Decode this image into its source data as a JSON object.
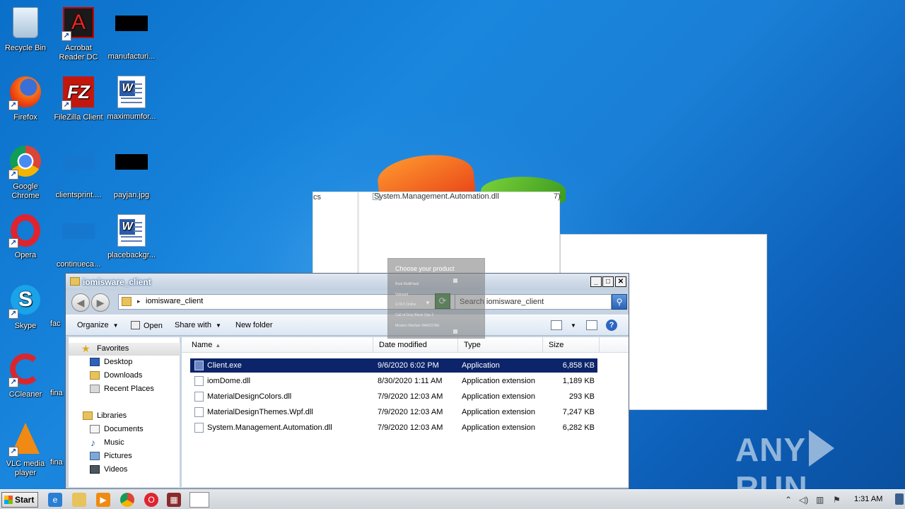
{
  "desktop": {
    "icons": [
      {
        "label": "Recycle Bin",
        "icon": "recycle-bin-icon"
      },
      {
        "label": "Acrobat Reader DC",
        "icon": "acrobat-icon"
      },
      {
        "label": "manufacturi...",
        "icon": "black-thumbnail-icon"
      },
      {
        "label": "Firefox",
        "icon": "firefox-icon"
      },
      {
        "label": "FileZilla Client",
        "icon": "filezilla-icon"
      },
      {
        "label": "maximumfor...",
        "icon": "word-document-icon"
      },
      {
        "label": "Google Chrome",
        "icon": "chrome-icon"
      },
      {
        "label": "clientsprint....",
        "icon": "blue-thumbnail-icon"
      },
      {
        "label": "payjan.jpg",
        "icon": "black-thumbnail-icon"
      },
      {
        "label": "Opera",
        "icon": "opera-icon"
      },
      {
        "label": "continueca...",
        "icon": "blue-thumbnail-icon"
      },
      {
        "label": "placebackgr...",
        "icon": "word-document-icon"
      },
      {
        "label": "Skype",
        "icon": "skype-icon"
      },
      {
        "label": "fac",
        "icon": "partial-icon"
      },
      {
        "label": "CCleaner",
        "icon": "ccleaner-icon"
      },
      {
        "label": "fina",
        "icon": "partial-icon"
      },
      {
        "label": "VLC media player",
        "icon": "vlc-icon"
      },
      {
        "label": "fina",
        "icon": "partial-icon"
      }
    ]
  },
  "background_windows": {
    "left_text": "cs",
    "file_text": "System.Management.Automation.dll",
    "right_fragment": "7)"
  },
  "explorer": {
    "title": "iomisware_client",
    "address_path": "iomisware_client",
    "search_placeholder": "Search iomisware_client",
    "toolbar": {
      "organize": "Organize",
      "open": "Open",
      "share_with": "Share with",
      "new_folder": "New folder"
    },
    "nav": {
      "favorites": "Favorites",
      "desktop": "Desktop",
      "downloads": "Downloads",
      "recent_places": "Recent Places",
      "libraries": "Libraries",
      "documents": "Documents",
      "music": "Music",
      "pictures": "Pictures",
      "videos": "Videos"
    },
    "columns": {
      "name": "Name",
      "date": "Date modified",
      "type": "Type",
      "size": "Size"
    },
    "files": [
      {
        "name": "Client.exe",
        "date": "9/6/2020 6:02 PM",
        "type": "Application",
        "size": "6,858 KB",
        "selected": true
      },
      {
        "name": "iomDome.dll",
        "date": "8/30/2020 1:11 AM",
        "type": "Application extension",
        "size": "1,189 KB"
      },
      {
        "name": "MaterialDesignColors.dll",
        "date": "7/9/2020 12:03 AM",
        "type": "Application extension",
        "size": "293 KB"
      },
      {
        "name": "MaterialDesignThemes.Wpf.dll",
        "date": "7/9/2020 12:03 AM",
        "type": "Application extension",
        "size": "7,247 KB"
      },
      {
        "name": "System.Management.Automation.dll",
        "date": "7/9/2020 12:03 AM",
        "type": "Application extension",
        "size": "6,282 KB"
      }
    ]
  },
  "popup": {
    "title": "Choose your product",
    "options": [
      "Rust MultiHack",
      "Valorant",
      "GTA 5 Online",
      "Call of Duty Black Ops 2",
      "Modern Warfare WARZONE"
    ]
  },
  "taskbar": {
    "start": "Start",
    "clock": "1:31 AM"
  },
  "watermark": {
    "left": "ANY",
    "right": "RUN"
  },
  "colors": {
    "selection": "#0b246a",
    "desktop": "#1a86dd",
    "taskbar": "#dadde2"
  }
}
